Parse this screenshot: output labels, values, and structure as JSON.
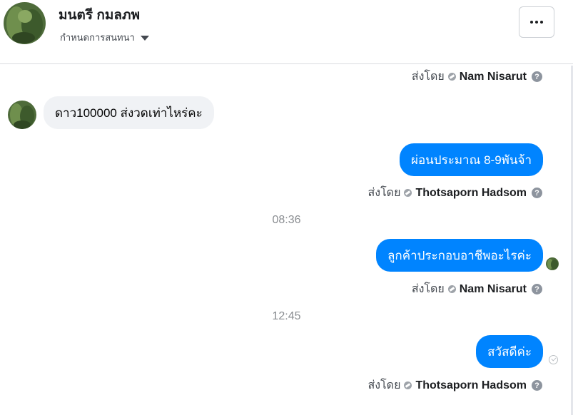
{
  "header": {
    "name": "มนตรี กมลภพ",
    "subtitle": "กำหนดการสนทนา",
    "more_label": "···"
  },
  "sent_by_prefix": "ส่งโดย",
  "messages": [
    {
      "sender_name": "Nam Nisarut"
    },
    {
      "incoming_text": "ดาว100000 ส่งวดเท่าไหร่คะ"
    },
    {
      "outgoing_text": "ผ่อนประมาณ 8-9พันจ้า",
      "sender_name": "Thotsaporn Hadsom"
    },
    {
      "time": "08:36"
    },
    {
      "outgoing_text": "ลูกค้าประกอบอาชีพอะไรค่ะ",
      "sender_name": "Nam Nisarut"
    },
    {
      "time": "12:45"
    },
    {
      "outgoing_text": "สวัสดีค่ะ",
      "sender_name": "Thotsaporn Hadsom"
    }
  ],
  "colors": {
    "accent": "#0084ff",
    "incoming_bg": "#f0f2f5"
  }
}
